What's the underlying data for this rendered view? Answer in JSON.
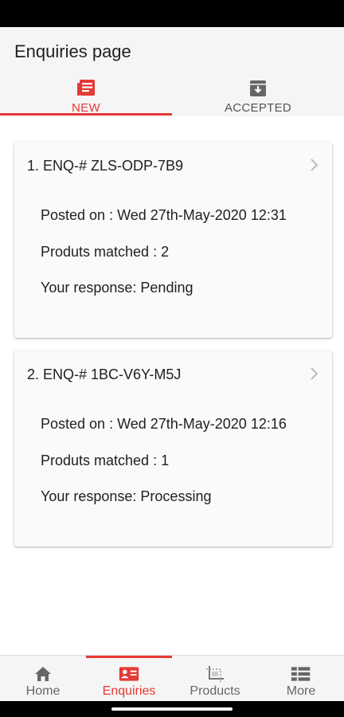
{
  "header": {
    "title": "Enquiries page"
  },
  "tabs": [
    {
      "label": "NEW",
      "icon": "news-icon",
      "active": true
    },
    {
      "label": "ACCEPTED",
      "icon": "archive-icon",
      "active": false
    }
  ],
  "colors": {
    "accent": "#e53935",
    "inactive": "#666666",
    "card_bg": "#fafafa",
    "bar_bg": "#f5f5f5"
  },
  "enquiries": [
    {
      "title": "1. ENQ-# ZLS-ODP-7B9",
      "posted": "Posted on : Wed 27th-May-2020 12:31",
      "matched": "Produts matched : 2",
      "response": "Your response: Pending"
    },
    {
      "title": "2. ENQ-# 1BC-V6Y-M5J",
      "posted": "Posted on : Wed 27th-May-2020 12:16",
      "matched": "Produts matched : 1",
      "response": "Your response: Processing"
    }
  ],
  "bottom_nav": [
    {
      "label": "Home",
      "icon": "home-icon",
      "active": false
    },
    {
      "label": "Enquiries",
      "icon": "contact-card-icon",
      "active": true
    },
    {
      "label": "Products",
      "icon": "crop-frame-icon",
      "active": false
    },
    {
      "label": "More",
      "icon": "grid-menu-icon",
      "active": false
    }
  ]
}
